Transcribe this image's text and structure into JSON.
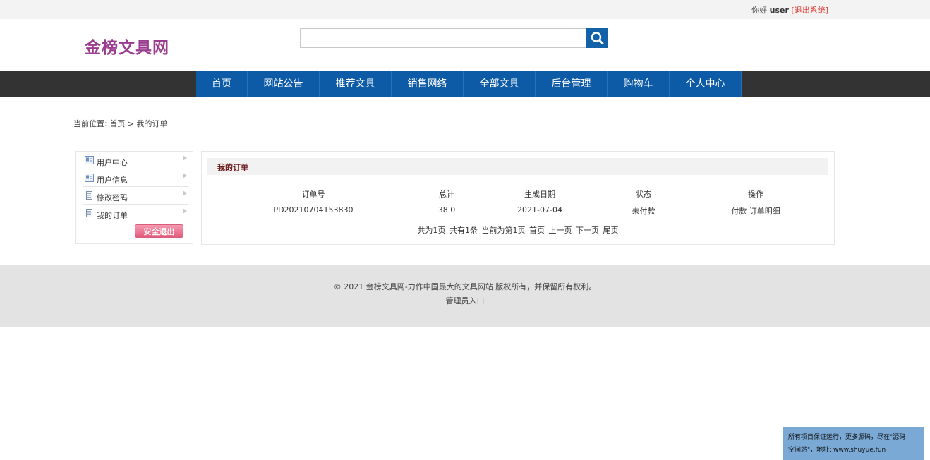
{
  "topbar": {
    "greeting": "你好",
    "username": "user",
    "logout_link": "[退出系统]"
  },
  "header": {
    "logo_text": "金榜文具网",
    "search": {
      "value": "",
      "placeholder": ""
    },
    "colors": {
      "logo": "#9b3d8f",
      "nav": "#0d5aa7",
      "search_button": "#1361a8"
    }
  },
  "nav": {
    "items": [
      "首页",
      "网站公告",
      "推荐文具",
      "销售网络",
      "全部文具",
      "后台管理",
      "购物车",
      "个人中心"
    ]
  },
  "breadcrumb": {
    "prefix": "当前位置:",
    "home": "首页",
    "separator": ">",
    "current": "我的订单"
  },
  "sidebar": {
    "items": [
      "用户中心",
      "用户信息",
      "修改密码",
      "我的订单"
    ],
    "logout_button": "安全退出"
  },
  "orders": {
    "title": "我的订单",
    "columns": [
      "订单号",
      "总计",
      "生成日期",
      "状态",
      "操作"
    ],
    "rows": [
      {
        "order_no": "PD20210704153830",
        "total": "38.0",
        "date": "2021-07-04",
        "status": "未付款",
        "action_pay": "付款",
        "action_detail": "订单明细"
      }
    ],
    "pager": {
      "total_pages": "共为1页",
      "total_items": "共有1条",
      "current": "当前为第1页",
      "first": "首页",
      "prev": "上一页",
      "next": "下一页",
      "last": "尾页"
    }
  },
  "footer": {
    "copyright": "© 2021 金榜文具网-力作中国最大的文具网站 版权所有，并保留所有权利。",
    "admin_link": "管理员入口"
  },
  "corner_notice": {
    "line1": "所有项目保证运行，更多源码，尽在\"源码",
    "line2": "空间站\"，地址: www.shuyue.fun"
  }
}
